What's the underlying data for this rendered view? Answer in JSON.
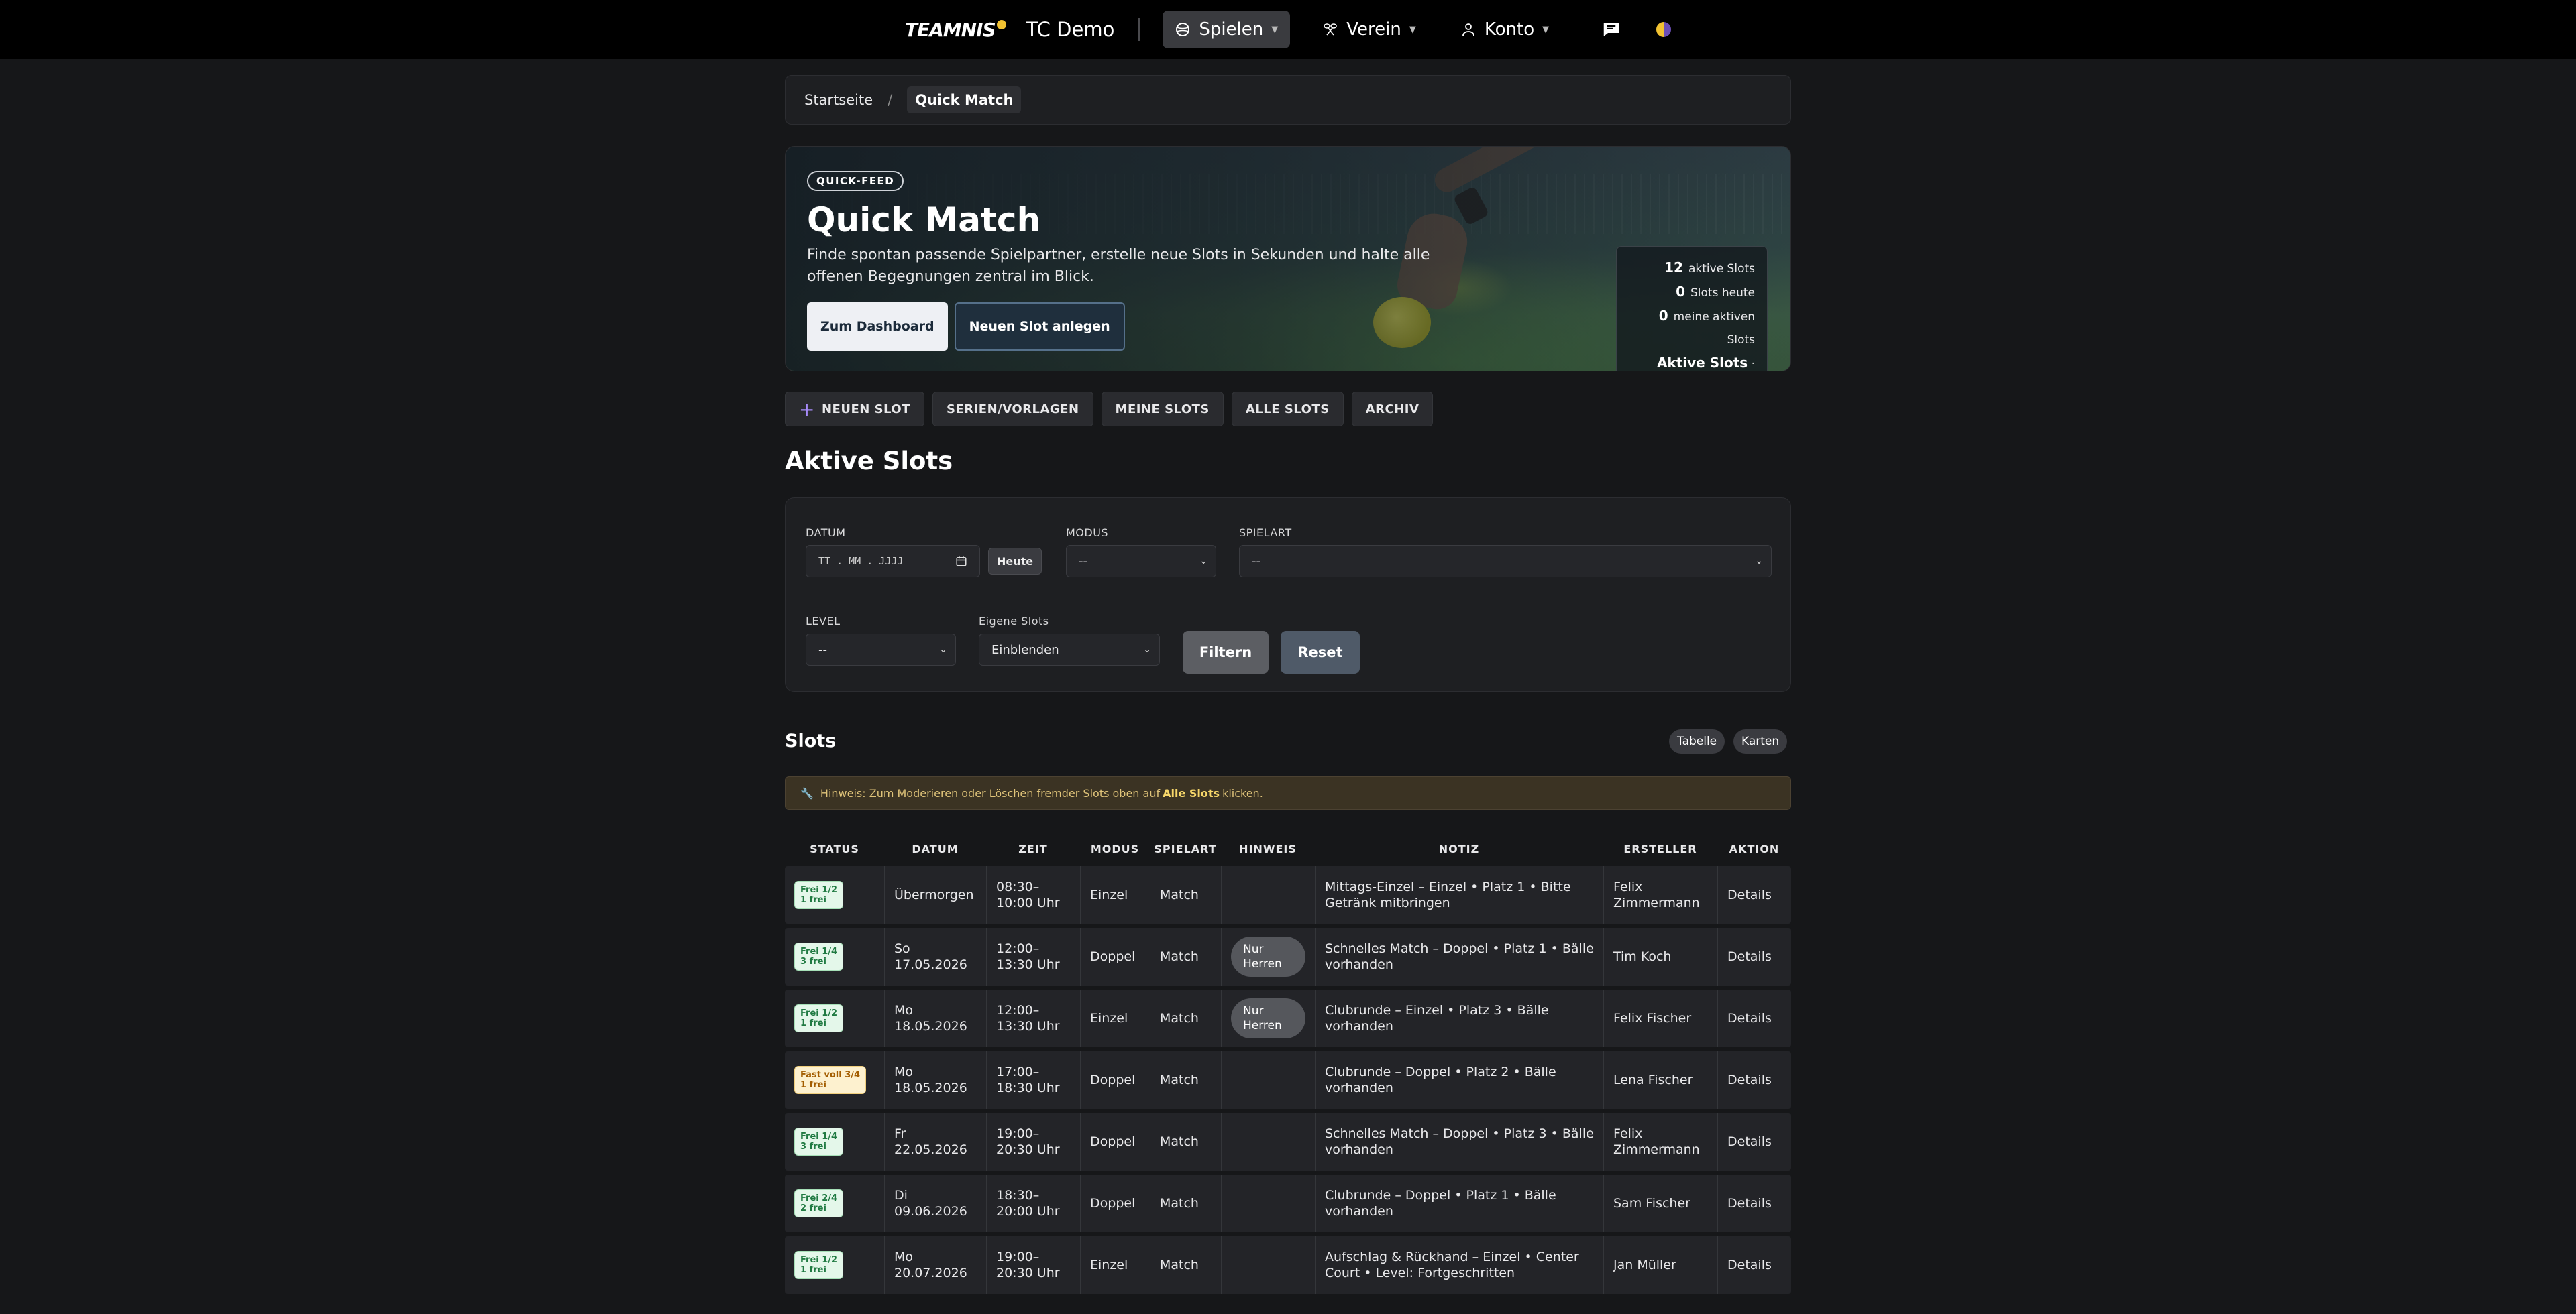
{
  "nav": {
    "logo": "TEAMNIS",
    "club": "TC Demo",
    "items": [
      {
        "label": "Spielen",
        "icon": "tennis-ball-icon",
        "active": true
      },
      {
        "label": "Verein",
        "icon": "crossed-rackets-icon"
      },
      {
        "label": "Konto",
        "icon": "user-icon"
      }
    ],
    "chat_icon": "chat-icon",
    "theme_icon": "theme-toggle-icon"
  },
  "breadcrumb": {
    "home": "Startseite",
    "separator": "/",
    "current": "Quick Match"
  },
  "hero": {
    "badge": "QUICK-FEED",
    "title": "Quick Match",
    "description": "Finde spontan passende Spielpartner, erstelle neue Slots in Sekunden und halte alle offenen Begegnungen zentral im Blick.",
    "btn_dashboard": "Zum Dashboard",
    "btn_new_slot": "Neuen Slot anlegen",
    "stats": [
      {
        "value": "12",
        "label": "aktive Slots"
      },
      {
        "value": "0",
        "label": "Slots heute"
      },
      {
        "value": "0",
        "label": "meine aktiven Slots"
      }
    ],
    "view_label": "Aktive Slots",
    "view_suffix": "· Ansicht"
  },
  "tabs": [
    "NEUEN SLOT",
    "SERIEN/VORLAGEN",
    "MEINE SLOTS",
    "ALLE SLOTS",
    "ARCHIV"
  ],
  "section_title": "Aktive Slots",
  "filter": {
    "datum_label": "DATUM",
    "datum_placeholder": "TT . MM . JJJJ",
    "heute": "Heute",
    "modus_label": "MODUS",
    "modus_value": "--",
    "spielart_label": "SPIELART",
    "spielart_value": "--",
    "level_label": "LEVEL",
    "level_value": "--",
    "eigene_label": "Eigene Slots",
    "eigene_value": "Einblenden",
    "filtern": "Filtern",
    "reset": "Reset"
  },
  "slots": {
    "title": "Slots",
    "view_table": "Tabelle",
    "view_cards": "Karten",
    "hint_prefix": "Hinweis: Zum Moderieren oder Löschen fremder Slots oben auf",
    "hint_link": "Alle Slots",
    "hint_suffix": "klicken.",
    "columns": [
      "STATUS",
      "DATUM",
      "ZEIT",
      "MODUS",
      "SPIELART",
      "HINWEIS",
      "NOTIZ",
      "ERSTELLER",
      "AKTION"
    ],
    "rows": [
      {
        "status1": "Frei 1/2",
        "status2": "1 frei",
        "status_color": "green",
        "datum": "Übermorgen",
        "zeit": "08:30–10:00 Uhr",
        "modus": "Einzel",
        "spielart": "Match",
        "hinweis": "",
        "notiz": "Mittags-Einzel – Einzel • Platz 1 • Bitte Getränk mitbringen",
        "ersteller": "Felix Zimmermann",
        "aktion": "Details"
      },
      {
        "status1": "Frei 1/4",
        "status2": "3 frei",
        "status_color": "green",
        "datum": "So 17.05.2026",
        "zeit": "12:00–13:30 Uhr",
        "modus": "Doppel",
        "spielart": "Match",
        "hinweis": "Nur Herren",
        "notiz": "Schnelles Match – Doppel • Platz 1 • Bälle vorhanden",
        "ersteller": "Tim Koch",
        "aktion": "Details"
      },
      {
        "status1": "Frei 1/2",
        "status2": "1 frei",
        "status_color": "green",
        "datum": "Mo 18.05.2026",
        "zeit": "12:00–13:30 Uhr",
        "modus": "Einzel",
        "spielart": "Match",
        "hinweis": "Nur Herren",
        "notiz": "Clubrunde – Einzel • Platz 3 • Bälle vorhanden",
        "ersteller": "Felix Fischer",
        "aktion": "Details"
      },
      {
        "status1": "Fast voll 3/4",
        "status2": "1 frei",
        "status_color": "amber",
        "datum": "Mo 18.05.2026",
        "zeit": "17:00–18:30 Uhr",
        "modus": "Doppel",
        "spielart": "Match",
        "hinweis": "",
        "notiz": "Clubrunde – Doppel • Platz 2 • Bälle vorhanden",
        "ersteller": "Lena Fischer",
        "aktion": "Details"
      },
      {
        "status1": "Frei 1/4",
        "status2": "3 frei",
        "status_color": "green",
        "datum": "Fr 22.05.2026",
        "zeit": "19:00–20:30 Uhr",
        "modus": "Doppel",
        "spielart": "Match",
        "hinweis": "",
        "notiz": "Schnelles Match – Doppel • Platz 3 • Bälle vorhanden",
        "ersteller": "Felix Zimmermann",
        "aktion": "Details"
      },
      {
        "status1": "Frei 2/4",
        "status2": "2 frei",
        "status_color": "green",
        "datum": "Di 09.06.2026",
        "zeit": "18:30–20:00 Uhr",
        "modus": "Doppel",
        "spielart": "Match",
        "hinweis": "",
        "notiz": "Clubrunde – Doppel • Platz 1 • Bälle vorhanden",
        "ersteller": "Sam Fischer",
        "aktion": "Details"
      },
      {
        "status1": "Frei 1/2",
        "status2": "1 frei",
        "status_color": "green",
        "datum": "Mo 20.07.2026",
        "zeit": "19:00–20:30 Uhr",
        "modus": "Einzel",
        "spielart": "Match",
        "hinweis": "",
        "notiz": "Aufschlag & Rückhand – Einzel • Center Court • Level: Fortgeschritten",
        "ersteller": "Jan Müller",
        "aktion": "Details"
      }
    ]
  }
}
